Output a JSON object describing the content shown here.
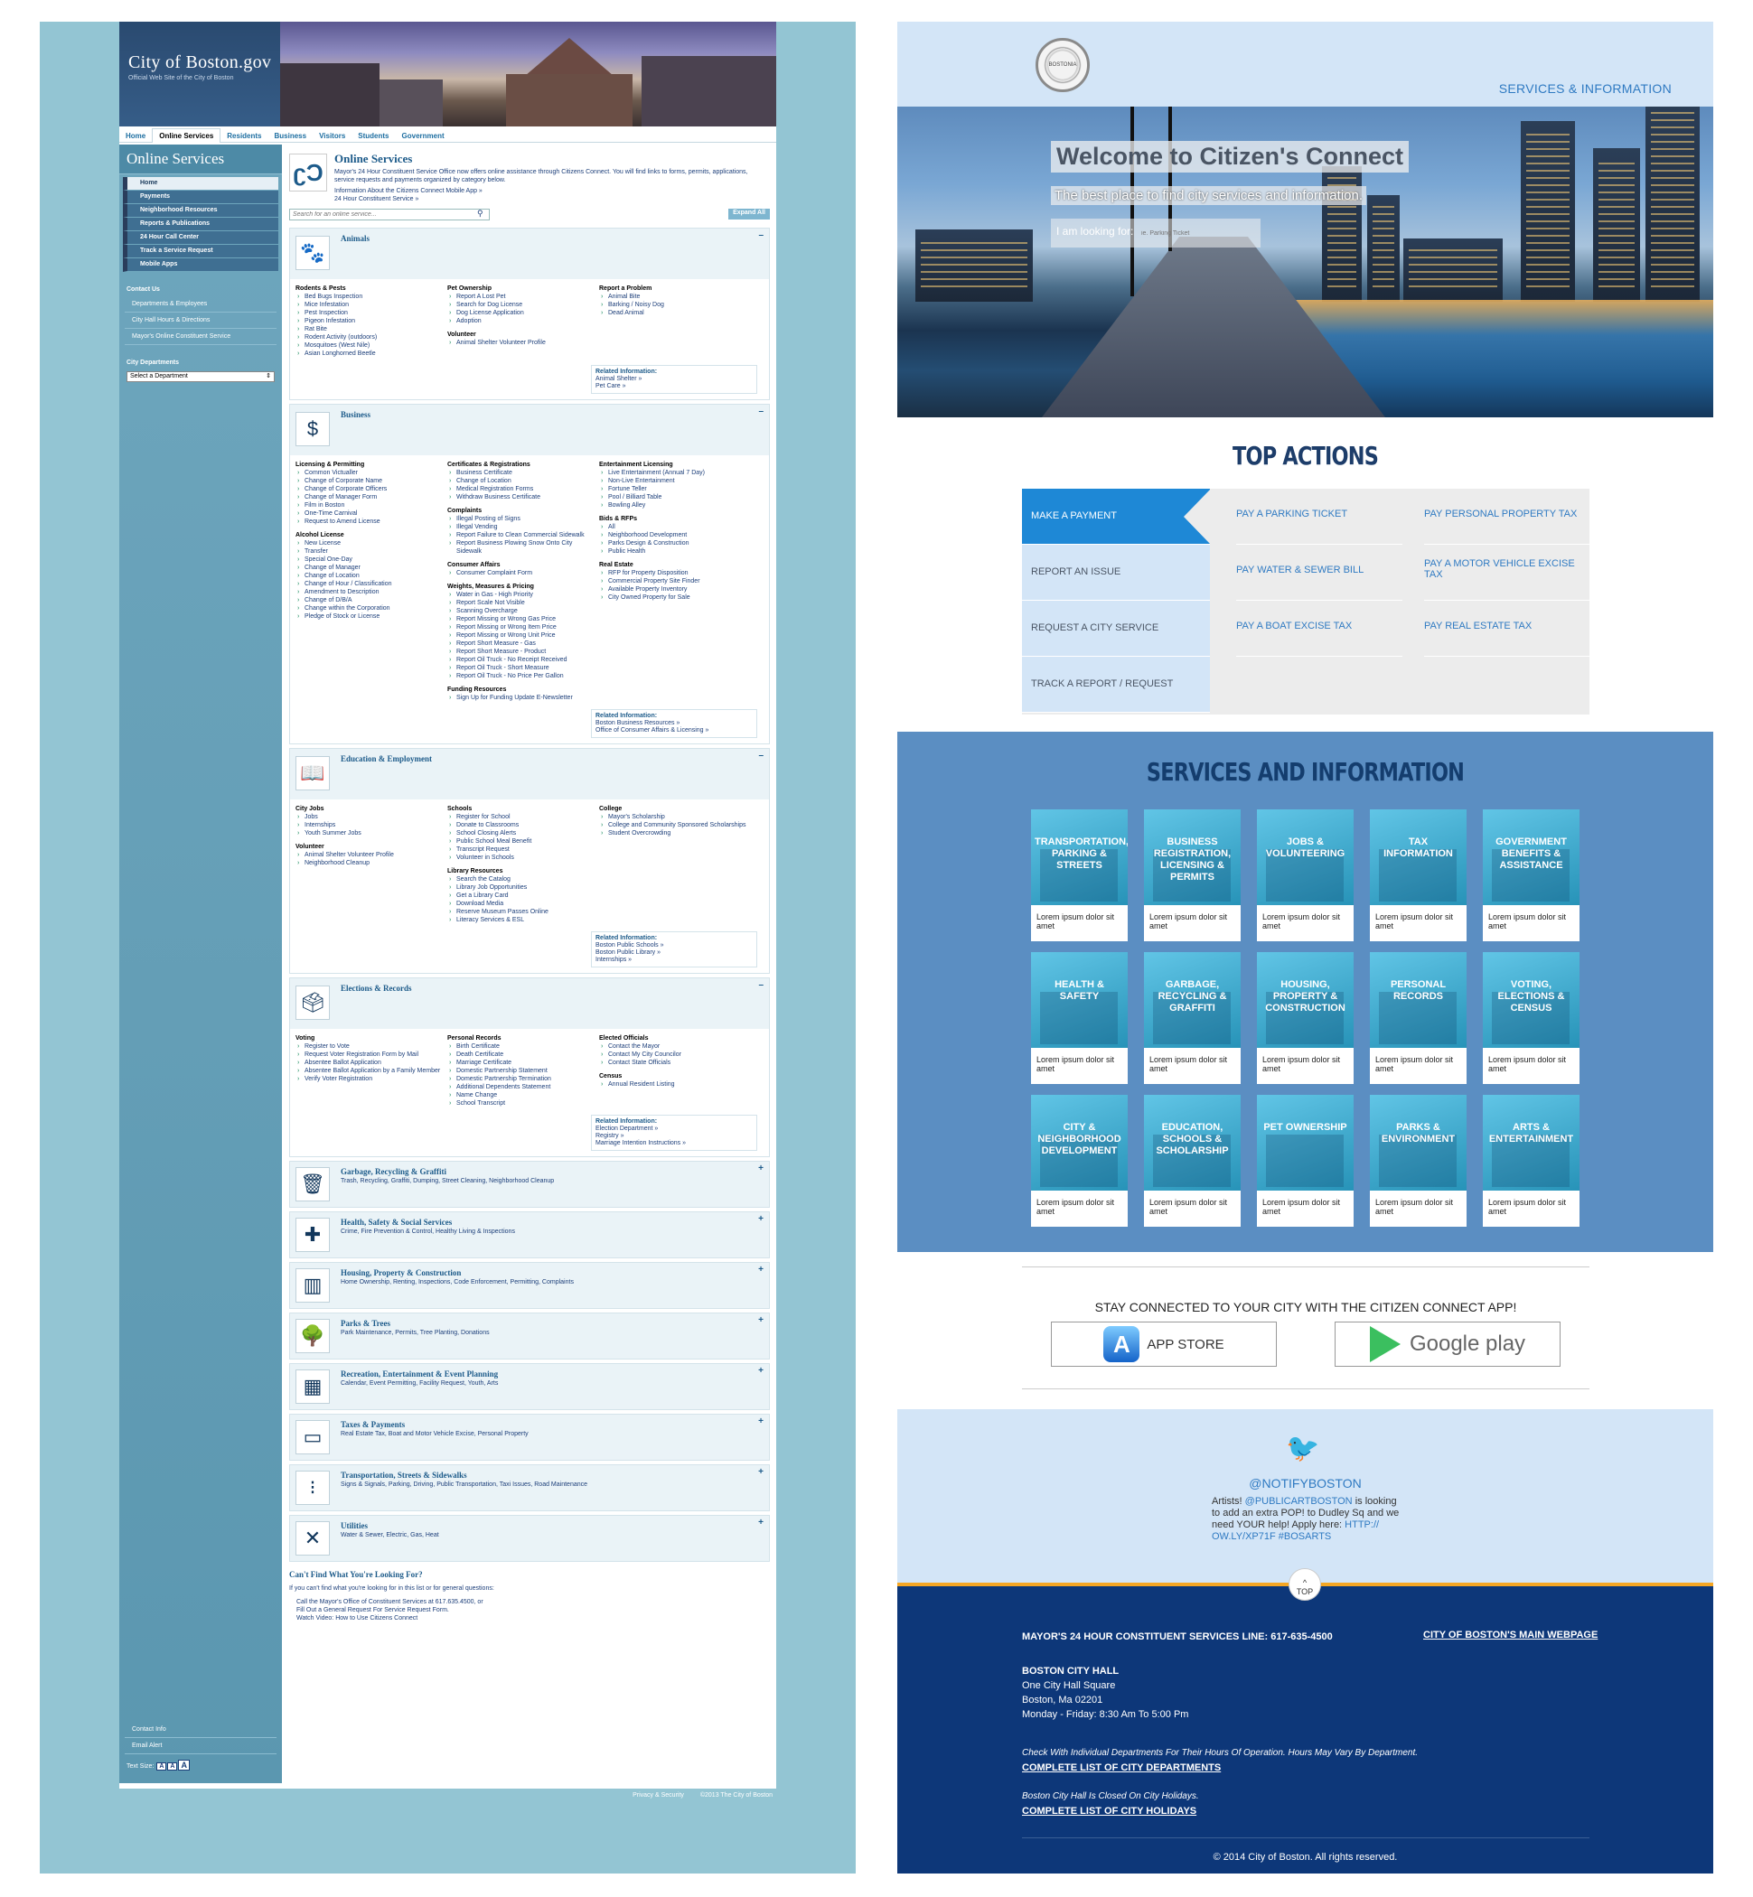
{
  "old_site": {
    "brand_line1": "City of Boston.gov",
    "brand_line2": "Official Web Site of the City of Boston",
    "nav": [
      "Home",
      "Online Services",
      "Residents",
      "Business",
      "Visitors",
      "Students",
      "Government"
    ],
    "sidebar": {
      "title": "Online Services",
      "items": [
        "Home",
        "Payments",
        "Neighborhood Resources",
        "Reports & Publications",
        "24 Hour Call Center",
        "Track a Service Request",
        "Mobile Apps"
      ],
      "contact_head": "Contact Us",
      "contact_links": [
        "Departments & Employees",
        "City Hall Hours & Directions",
        "Mayor's Online Constituent Service"
      ],
      "dept_head": "City Departments",
      "dept_select": "Select a Department",
      "bottom_links": [
        "Contact Info",
        "Email Alert"
      ],
      "text_size": "Text Size:"
    },
    "intro": {
      "title": "Online Services",
      "body": "Mayor's 24 Hour Constituent Service Office now offers online assistance through Citizens Connect. You will find links to forms, permits, applications, service requests and payments organized by category below.",
      "link1": "Information About the Citizens Connect Mobile App »",
      "link2": "24 Hour Constituent Service »"
    },
    "search_placeholder": "Search for an online service...",
    "expand_all": "Expand All",
    "categories": [
      {
        "title": "Animals",
        "icon": "paw-icon",
        "cols": [
          [
            {
              "h": "Rodents & Pests",
              "i": [
                "Bed Bugs Inspection",
                "Mice Infestation",
                "Pest Inspection",
                "Pigeon Infestation",
                "Rat Bite",
                "Rodent Activity (outdoors)",
                "Mosquitoes (West Nile)",
                "Asian Longhorned Beetle"
              ]
            }
          ],
          [
            {
              "h": "Pet Ownership",
              "i": [
                "Report A Lost Pet",
                "Search for Dog License",
                "Dog License Application",
                "Adoption"
              ]
            },
            {
              "h": "Volunteer",
              "i": [
                "Animal Shelter Volunteer Profile"
              ]
            }
          ],
          [
            {
              "h": "Report a Problem",
              "i": [
                "Animal Bite",
                "Barking / Noisy Dog",
                "Dead Animal"
              ]
            }
          ]
        ],
        "rel": [
          "Animal Shelter »",
          "Pet Care »"
        ]
      },
      {
        "title": "Business",
        "icon": "dollar-icon",
        "cols": [
          [
            {
              "h": "Licensing & Permitting",
              "i": [
                "Common Victualler",
                "Change of Corporate Name",
                "Change of Corporate Officers",
                "Change of Manager Form",
                "Film in Boston",
                "One-Time Carnival",
                "Request to Amend License"
              ]
            },
            {
              "h": "Alcohol License",
              "i": [
                "New License",
                "Transfer",
                "Special One-Day",
                "Change of Manager",
                "Change of Location",
                "Change of Hour / Classification",
                "Amendment to Description",
                "Change of D/B/A",
                "Change within the Corporation",
                "Pledge of Stock or License"
              ]
            }
          ],
          [
            {
              "h": "Certificates & Registrations",
              "i": [
                "Business Certificate",
                "Change of Location",
                "Medical Registration Forms",
                "Withdraw Business Certificate"
              ]
            },
            {
              "h": "Complaints",
              "i": [
                "Illegal Posting of Signs",
                "Illegal Vending",
                "Report Failure to Clean Commercial Sidewalk",
                "Report Business Plowing Snow Onto City Sidewalk"
              ]
            },
            {
              "h": "Consumer Affairs",
              "i": [
                "Consumer Complaint Form"
              ]
            },
            {
              "h": "Weights, Measures & Pricing",
              "i": [
                "Water in Gas - High Priority",
                "Report Scale Not Visible",
                "Scanning Overcharge",
                "Report Missing or Wrong Gas Price",
                "Report Missing or Wrong Item Price",
                "Report Missing or Wrong Unit Price",
                "Report Short Measure - Gas",
                "Report Short Measure - Product",
                "Report Oil Truck - No Receipt Received",
                "Report Oil Truck - Short Measure",
                "Report Oil Truck - No Price Per Gallon"
              ]
            },
            {
              "h": "Funding Resources",
              "i": [
                "Sign Up for Funding Update E-Newsletter"
              ]
            }
          ],
          [
            {
              "h": "Entertainment Licensing",
              "i": [
                "Live Entertainment (Annual 7 Day)",
                "Non-Live Entertainment",
                "Fortune Teller",
                "Pool / Billiard Table",
                "Bowling Alley"
              ]
            },
            {
              "h": "Bids & RFPs",
              "i": [
                "All",
                "Neighborhood Development",
                "Parks Design & Construction",
                "Public Health"
              ]
            },
            {
              "h": "Real Estate",
              "i": [
                "RFP for Property Disposition",
                "Commercial Property Site Finder",
                "Available Property Inventory",
                "City Owned Property for Sale"
              ]
            }
          ]
        ],
        "rel": [
          "Boston Business Resources »",
          "Office of Consumer Affairs & Licensing »"
        ]
      },
      {
        "title": "Education & Employment",
        "icon": "book-icon",
        "cols": [
          [
            {
              "h": "City Jobs",
              "i": [
                "Jobs",
                "Internships",
                "Youth Summer Jobs"
              ]
            },
            {
              "h": "Volunteer",
              "i": [
                "Animal Shelter Volunteer Profile",
                "Neighborhood Cleanup"
              ]
            }
          ],
          [
            {
              "h": "Schools",
              "i": [
                "Register for School",
                "Donate to Classrooms",
                "School Closing Alerts",
                "Public School Meal Benefit",
                "Transcript Request",
                "Volunteer in Schools"
              ]
            },
            {
              "h": "Library Resources",
              "i": [
                "Search the Catalog",
                "Library Job Opportunities",
                "Get a Library Card",
                "Download Media",
                "Reserve Museum Passes Online",
                "Literacy Services & ESL"
              ]
            }
          ],
          [
            {
              "h": "College",
              "i": [
                "Mayor's Scholarship",
                "College and Community Sponsored Scholarships",
                "Student Overcrowding"
              ]
            }
          ]
        ],
        "rel": [
          "Boston Public Schools »",
          "Boston Public Library »",
          "Internships »"
        ]
      },
      {
        "title": "Elections & Records",
        "icon": "ballot-icon",
        "cols": [
          [
            {
              "h": "Voting",
              "i": [
                "Register to Vote",
                "Request Voter Registration Form by Mail",
                "Absentee Ballot Application",
                "Absentee Ballot Application by a Family Member",
                "Verify Voter Registration"
              ]
            }
          ],
          [
            {
              "h": "Personal Records",
              "i": [
                "Birth Certificate",
                "Death Certificate",
                "Marriage Certificate",
                "Domestic Partnership Statement",
                "Domestic Partnership Termination",
                "Additional Dependents Statement",
                "Name Change",
                "School Transcript"
              ]
            }
          ],
          [
            {
              "h": "Elected Officials",
              "i": [
                "Contact the Mayor",
                "Contact My City Councilor",
                "Contact State Officials"
              ]
            },
            {
              "h": "Census",
              "i": [
                "Annual Resident Listing"
              ]
            }
          ]
        ],
        "rel": [
          "Election Department »",
          "Registry »",
          "Marriage Intention Instructions »"
        ]
      }
    ],
    "collapsed": [
      {
        "title": "Garbage, Recycling & Graffiti",
        "sub": "Trash, Recycling, Graffiti, Dumping, Street Cleaning, Neighborhood Cleanup",
        "icon": "trash-icon"
      },
      {
        "title": "Health, Safety & Social Services",
        "sub": "Crime, Fire Prevention & Control, Healthy Living & Inspections",
        "icon": "cross-icon"
      },
      {
        "title": "Housing, Property & Construction",
        "sub": "Home Ownership, Renting, Inspections, Code Enforcement, Permitting, Complaints",
        "icon": "buildings-icon"
      },
      {
        "title": "Parks & Trees",
        "sub": "Park Maintenance, Permits, Tree Planting, Donations",
        "icon": "tree-icon"
      },
      {
        "title": "Recreation, Entertainment & Event Planning",
        "sub": "Calendar, Event Permitting, Facility Request, Youth, Arts",
        "icon": "calendar-icon"
      },
      {
        "title": "Taxes & Payments",
        "sub": "Real Estate Tax, Boat and Motor Vehicle Excise, Personal Property",
        "icon": "card-icon"
      },
      {
        "title": "Transportation, Streets & Sidewalks",
        "sub": "Signs & Signals, Parking, Driving, Public Transportation, Taxi Issues, Road Maintenance",
        "icon": "traffic-light-icon"
      },
      {
        "title": "Utilities",
        "sub": "Water & Sewer, Electric, Gas, Heat",
        "icon": "tools-icon"
      }
    ],
    "related_label": "Related Information:",
    "cant_find": {
      "title": "Can't Find What You're Looking For?",
      "body": "If you can't find what you're looking for in this list or for general questions:",
      "links": [
        "Call the Mayor's Office of Constituent Services at 617.635.4500, or",
        "Fill Out a General Request For Service Request Form.",
        "Watch Video: How to Use Citizens Connect"
      ]
    },
    "footer": [
      "Privacy & Security",
      "©2013 The City of Boston"
    ]
  },
  "new_site": {
    "nav": "SERVICES & INFORMATION",
    "hero": {
      "title": "Welcome to Citizen's Connect",
      "subtitle": "The best place to find city services and information.",
      "search_label": "I am looking for:",
      "search_placeholder": "ie. Parking Ticket"
    },
    "top_actions": {
      "title": "TOP ACTIONS",
      "left": [
        "MAKE A PAYMENT",
        "REPORT AN ISSUE",
        "REQUEST A CITY SERVICE",
        "TRACK A REPORT / REQUEST"
      ],
      "col2": [
        "PAY A PARKING TICKET",
        "PAY WATER & SEWER BILL",
        "PAY A BOAT EXCISE TAX"
      ],
      "col3": [
        "PAY PERSONAL PROPERTY TAX",
        "PAY A MOTOR VEHICLE EXCISE TAX",
        "PAY REAL ESTATE TAX"
      ]
    },
    "services": {
      "title": "SERVICES AND INFORMATION",
      "desc": "Lorem ipsum dolor sit amet",
      "tiles": [
        "TRANSPORTATION, PARKING & STREETS",
        "BUSINESS REGISTRATION, LICENSING & PERMITS",
        "JOBS & VOLUNTEERING",
        "TAX INFORMATION",
        "GOVERNMENT BENEFITS & ASSISTANCE",
        "HEALTH & SAFETY",
        "GARBAGE, RECYCLING & GRAFFITI",
        "HOUSING, PROPERTY & CONSTRUCTION",
        "PERSONAL RECORDS",
        "VOTING, ELECTIONS & CENSUS",
        "CITY & NEIGHBORHOOD DEVELOPMENT",
        "EDUCATION, SCHOOLS & SCHOLARSHIP",
        "PET OWNERSHIP",
        "PARKS & ENVIRONMENT",
        "ARTS & ENTERTAINMENT"
      ]
    },
    "app": {
      "title": "STAY CONNECTED TO YOUR CITY WITH THE CITIZEN CONNECT APP!",
      "app_store": "APP STORE",
      "google_play": "Google play"
    },
    "twitter": {
      "handle": "@NOTIFYBOSTON",
      "text_pre": "Artists! ",
      "mention": "@PUBLICARTBOSTON",
      "text_mid": " is looking to add an extra POP! to Dudley Sq and we need YOUR help! Apply here: ",
      "link": "HTTP:// OW.LY/XP71F #BOSARTS"
    },
    "footer": {
      "top": "TOP",
      "line": "MAYOR'S 24 HOUR CONSTITUENT SERVICES LINE: 617-635-4500",
      "main": "CITY OF BOSTON'S MAIN WEBPAGE",
      "hall": "BOSTON CITY HALL",
      "addr1": "One City Hall Square",
      "addr2": "Boston, Ma 02201",
      "hours": "Monday - Friday: 8:30 Am To 5:00 Pm",
      "note1": "Check With Individual Departments For Their Hours Of Operation. Hours May Vary By Department.",
      "link1": "COMPLETE LIST OF CITY DEPARTMENTS",
      "note2": "Boston City Hall Is Closed On City Holidays.",
      "link2": "COMPLETE LIST OF CITY HOLIDAYS",
      "copy": "© 2014 City of Boston. All rights reserved."
    }
  }
}
